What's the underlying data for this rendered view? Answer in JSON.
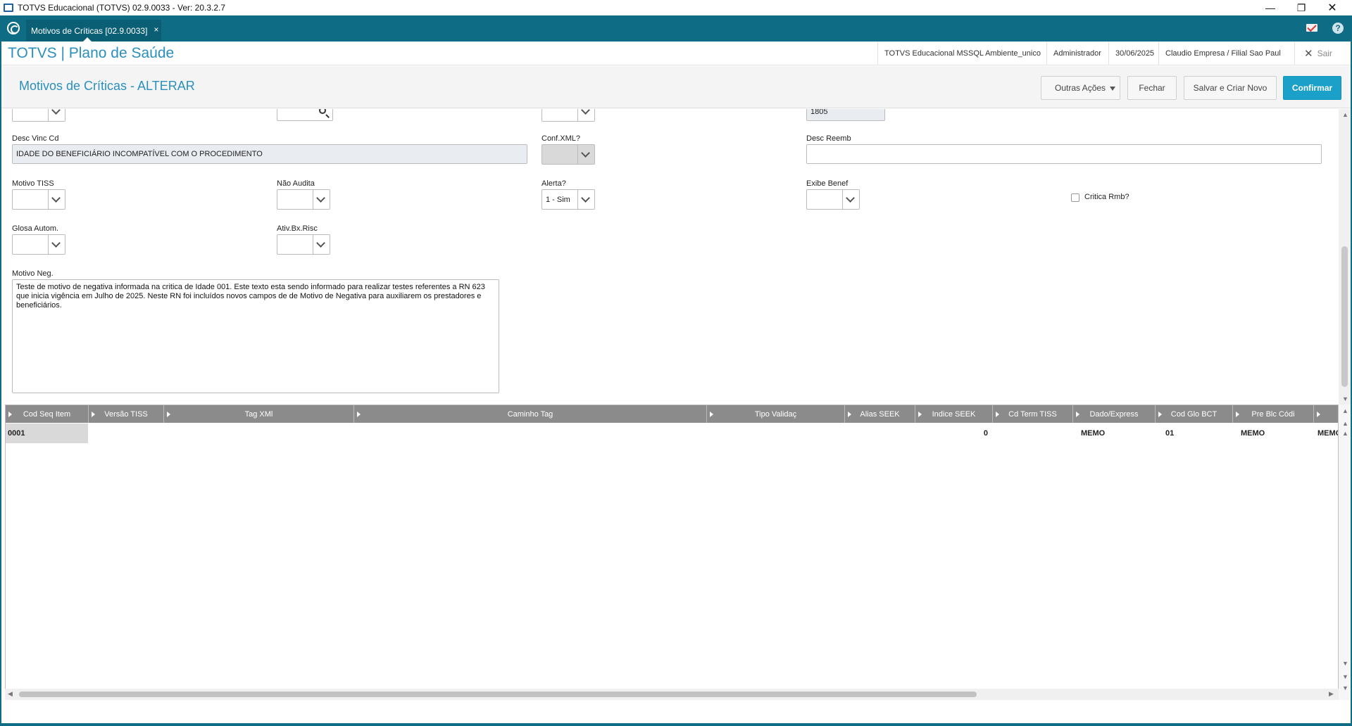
{
  "window": {
    "title": "TOTVS Educacional (TOTVS) 02.9.0033 - Ver: 20.3.2.7",
    "minimize": "—",
    "maximize": "❐",
    "close": "✕"
  },
  "tabs": [
    {
      "label": "Motivos de Críticas [02.9.0033]",
      "close": "×"
    }
  ],
  "header": {
    "brand": "TOTVS | Plano de Saúde",
    "environment": "TOTVS Educacional MSSQL Ambiente_unico",
    "user": "Administrador",
    "date": "30/06/2025",
    "company": "Claudio Empresa / Filial Sao Paul",
    "exit_label": "Sair"
  },
  "page": {
    "title": "Motivos de Críticas - ALTERAR",
    "buttons": {
      "other_actions": "Outras Ações",
      "close": "Fechar",
      "save_new": "Salvar e Criar Novo",
      "confirm": "Confirmar"
    }
  },
  "form": {
    "top_partial_value": "1805",
    "desc_vinc_cd": {
      "label": "Desc Vinc Cd",
      "value": "IDADE DO BENEFICIÁRIO INCOMPATÍVEL COM O PROCEDIMENTO"
    },
    "conf_xml": {
      "label": "Conf.XML?",
      "value": ""
    },
    "desc_reemb": {
      "label": "Desc Reemb",
      "value": ""
    },
    "motivo_tiss": {
      "label": "Motivo TISS",
      "value": ""
    },
    "nao_audita": {
      "label": "Não Audita",
      "value": ""
    },
    "alerta": {
      "label": "Alerta?",
      "value": "1 - Sim"
    },
    "exibe_benef": {
      "label": "Exibe Benef",
      "value": ""
    },
    "critica_rmb": {
      "label": "Critica Rmb?",
      "checked": false
    },
    "glosa_autom": {
      "label": "Glosa Autom.",
      "value": ""
    },
    "ativ_bx_risc": {
      "label": "Ativ.Bx.Risc",
      "value": ""
    },
    "motivo_neg": {
      "label": "Motivo Neg.",
      "value": "Teste de motivo de negativa informada na critica de Idade 001. Este texto esta sendo informado para realizar testes referentes a RN 623 que inicia vigência em Julho de 2025. Neste RN foi incluídos novos campos de de Motivo de Negativa para auxiliarem os prestadores e beneficiários."
    }
  },
  "grid": {
    "columns": [
      "Cod Seq Item",
      "Versão TISS",
      "Tag XMl",
      "Caminho Tag",
      "Tipo Validaç",
      "Alias SEEK",
      "Indice SEEK",
      "Cd Term TISS",
      "Dado/Express",
      "Cod Glo BCT",
      "Pre Blc Códi"
    ],
    "rows": [
      {
        "cod_seq_item": "0001",
        "versao_tiss": "",
        "tag_xml": "",
        "caminho_tag": "",
        "tipo_valid": "",
        "alias_seek": "",
        "indice_seek": "0",
        "cd_term_tiss": "",
        "dado_express": "MEMO",
        "cod_glo_bct": "01",
        "pre_blc_codi": "MEMO",
        "extra": "MEMO"
      }
    ]
  },
  "colors": {
    "teal_bar": "#0e6c84",
    "accent_blue": "#2a8fbd",
    "primary_button": "#1aa0c9",
    "grid_header": "#8b8b8b"
  }
}
